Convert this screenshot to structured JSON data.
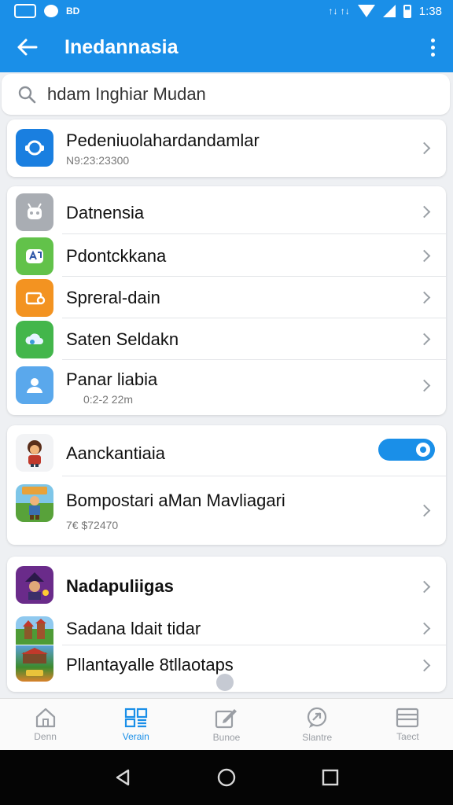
{
  "status_bar": {
    "left_text": "BD",
    "right_text": "1:38",
    "middle_text": "↑↓ ↑↓"
  },
  "app_bar": {
    "title": "Inedannasia"
  },
  "search": {
    "value": "hdam Inghiar Mudan"
  },
  "featured": {
    "title": "Pedeniuolahardandamlar",
    "subtitle": "N9:23:23300"
  },
  "settings_list": [
    {
      "title": "Datnensia",
      "icon": "robot-icon",
      "color": "#a9adb3"
    },
    {
      "title": "Pdontckkana",
      "icon": "translate-icon",
      "color": "#62c24a"
    },
    {
      "title": "Spreral-dain",
      "icon": "storage-icon",
      "color": "#f39321"
    },
    {
      "title": "Saten Seldakn",
      "icon": "cloud-icon",
      "color": "#43b64b"
    },
    {
      "title": "Panar liabia",
      "subtitle": "0:2-2 22m",
      "icon": "person-icon",
      "color": "#5aa8ec"
    }
  ],
  "games_section": {
    "toggle_row": {
      "title": "Aanckantiaia",
      "toggle_on": true
    },
    "game_row": {
      "title": "Bompostari aMan Mavliagari",
      "subtitle": "7€ $72470"
    }
  },
  "apps_section": [
    {
      "title": "Nadapuliigas",
      "bold": true
    },
    {
      "title": "Sadana ldait tidar"
    },
    {
      "title": "Pllantayalle 8tllaotaps"
    }
  ],
  "bottom_nav": [
    {
      "label": "Denn",
      "icon": "home-icon",
      "active": false
    },
    {
      "label": "Verain",
      "icon": "grid-icon",
      "active": true
    },
    {
      "label": "Bunoe",
      "icon": "edit-icon",
      "active": false
    },
    {
      "label": "Slantre",
      "icon": "chat-icon",
      "active": false
    },
    {
      "label": "Taect",
      "icon": "list-icon",
      "active": false
    }
  ],
  "colors": {
    "accent": "#1a8fe8",
    "background": "#eef0f3"
  }
}
